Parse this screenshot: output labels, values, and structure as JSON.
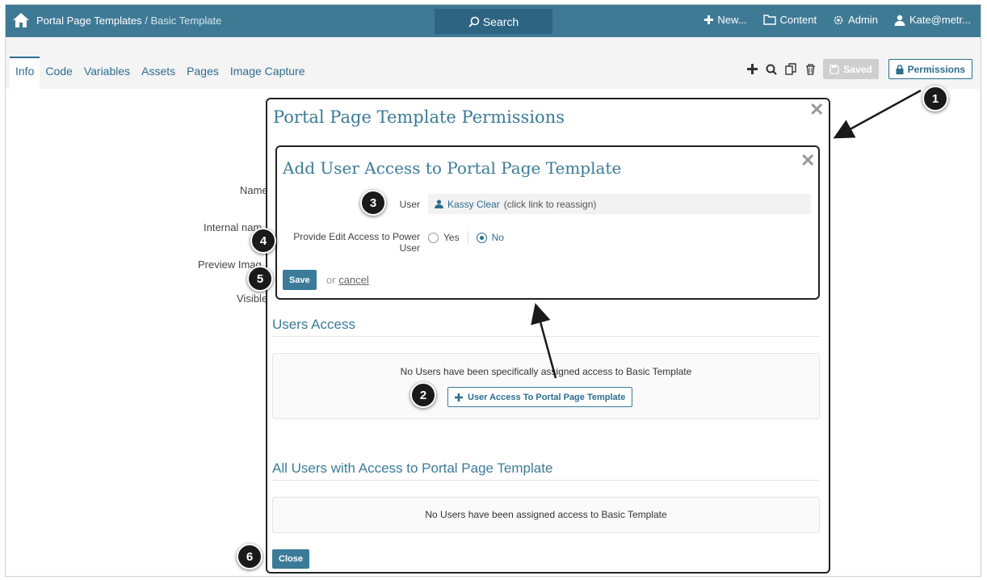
{
  "topbar": {
    "breadcrumb_root": "Portal Page Templates",
    "breadcrumb_sep": "/",
    "breadcrumb_current": "Basic Template",
    "search_label": "Search",
    "new_label": "New...",
    "content_label": "Content",
    "admin_label": "Admin",
    "user_label": "Kate@metr..."
  },
  "tabs": [
    "Info",
    "Code",
    "Variables",
    "Assets",
    "Pages",
    "Image Capture"
  ],
  "toolbar": {
    "saved_label": "Saved",
    "permissions_label": "Permissions"
  },
  "background_form": {
    "name_label": "Name",
    "internal_name_label": "Internal nam",
    "preview_image_label": "Preview Imag",
    "visible_label": "Visible"
  },
  "permissions_modal": {
    "title": "Portal Page Template Permissions",
    "users_access_heading": "Users Access",
    "users_access_empty": "No Users have been specifically assigned access to Basic Template",
    "add_user_access_button": "User Access To Portal Page Template",
    "all_users_heading": "All Users with Access to Portal Page Template",
    "all_users_empty": "No Users have been assigned access to Basic Template",
    "close_label": "Close"
  },
  "add_user_modal": {
    "title": "Add User Access to Portal Page Template",
    "user_label": "User",
    "user_name": "Kassy Clear",
    "user_hint": "(click link to reassign)",
    "edit_access_label": "Provide Edit Access to Power User",
    "option_yes": "Yes",
    "option_no": "No",
    "selected_option": "No",
    "save_label": "Save",
    "or_text": "or",
    "cancel_label": "cancel"
  },
  "callouts": [
    "1",
    "2",
    "3",
    "4",
    "5",
    "6"
  ],
  "colors": {
    "topbar": "#3f7a95",
    "accent": "#3b7b98",
    "link": "#2d6d8f",
    "callout": "#1a1a1a"
  }
}
